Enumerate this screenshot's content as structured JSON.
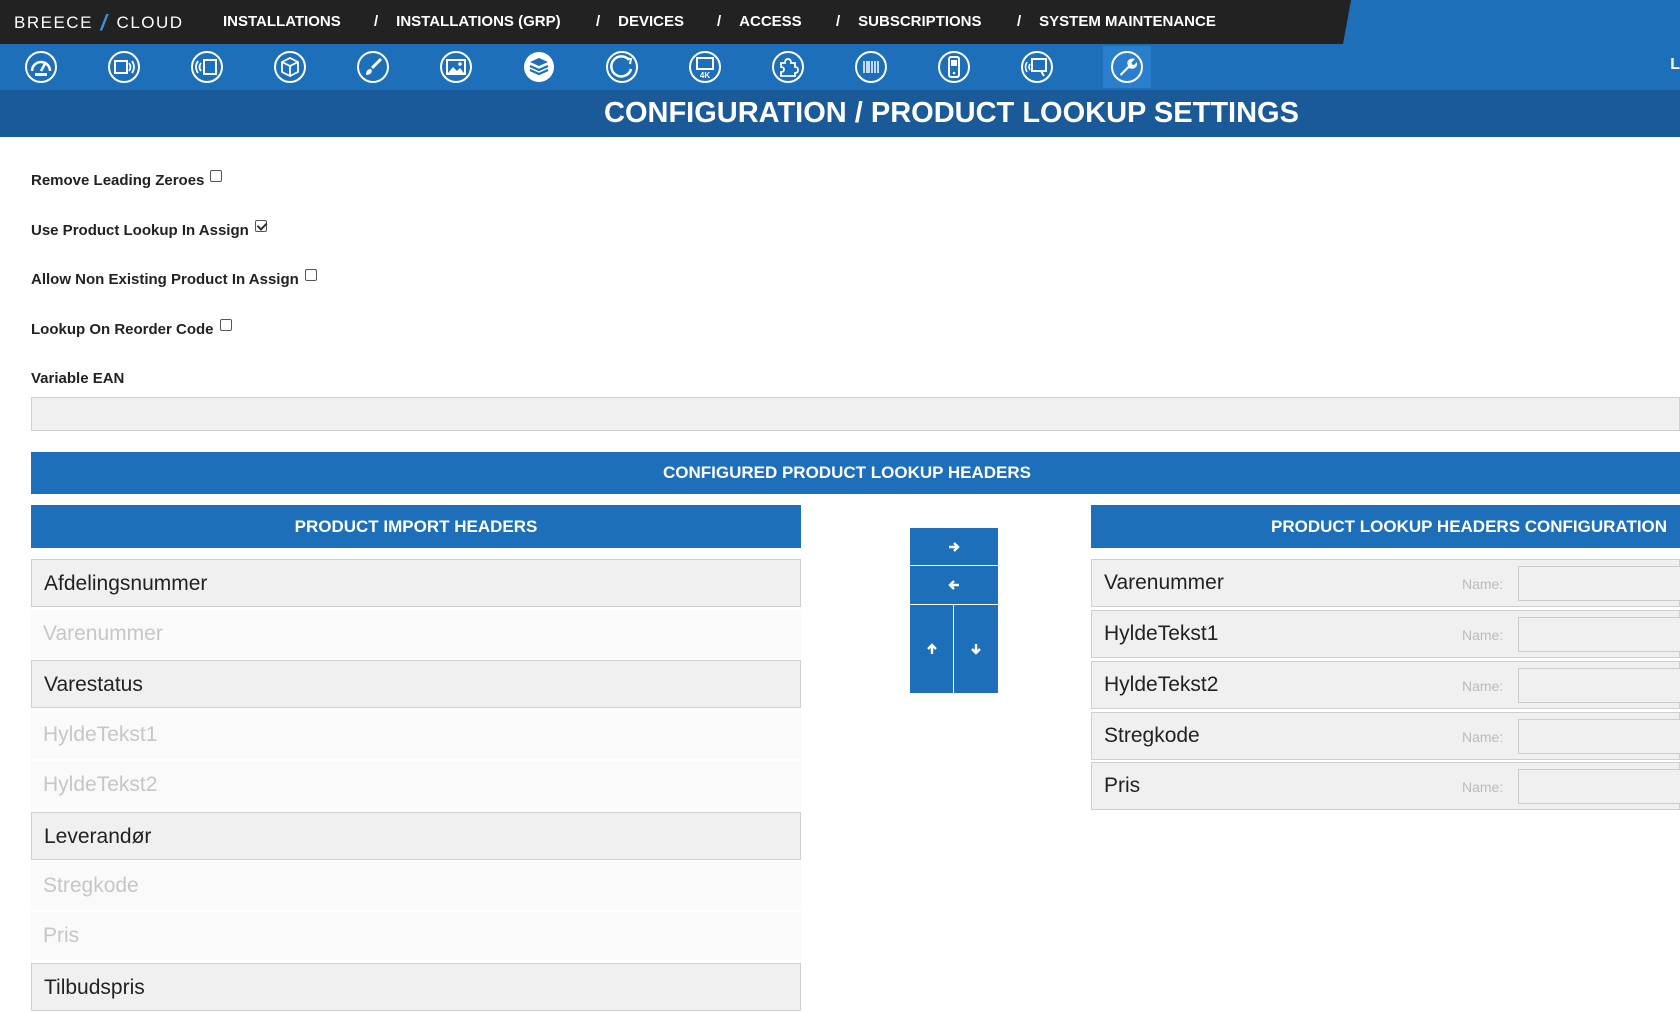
{
  "brand": {
    "left": "BREECE",
    "right": "CLOUD"
  },
  "topnav": [
    {
      "label": "INSTALLATIONS"
    },
    {
      "label": "INSTALLATIONS (GRP)"
    },
    {
      "label": "DEVICES"
    },
    {
      "label": "ACCESS"
    },
    {
      "label": "SUBSCRIPTIONS"
    },
    {
      "label": "SYSTEM MAINTENANCE"
    }
  ],
  "nav_separator": "/",
  "toolbar": {
    "icons": [
      "dashboard-icon",
      "sensor-icon",
      "wireless-tag-icon",
      "package-icon",
      "brush-icon",
      "gallery-icon",
      "layers-icon",
      "refresh-circle-icon",
      "monitor-4k-icon",
      "puzzle-icon",
      "barcode-scanner-icon",
      "handheld-device-icon",
      "signage-icon",
      "wrench-icon"
    ],
    "right_text": "L"
  },
  "page_title": "CONFIGURATION / PRODUCT LOOKUP SETTINGS",
  "options": [
    {
      "label": "Remove Leading Zeroes",
      "checked": false
    },
    {
      "label": "Use Product Lookup In Assign",
      "checked": true
    },
    {
      "label": "Allow Non Existing Product In Assign",
      "checked": false
    },
    {
      "label": "Lookup On Reorder Code",
      "checked": false
    }
  ],
  "variable_ean": {
    "label": "Variable EAN",
    "value": ""
  },
  "configured_header": "CONFIGURED PRODUCT LOOKUP HEADERS",
  "import_headers": {
    "title": "PRODUCT IMPORT HEADERS",
    "items": [
      {
        "label": "Afdelingsnummer",
        "enabled": true
      },
      {
        "label": "Varenummer",
        "enabled": false
      },
      {
        "label": "Varestatus",
        "enabled": true
      },
      {
        "label": "HyldeTekst1",
        "enabled": false
      },
      {
        "label": "HyldeTekst2",
        "enabled": false
      },
      {
        "label": "Leverandør",
        "enabled": true
      },
      {
        "label": "Stregkode",
        "enabled": false
      },
      {
        "label": "Pris",
        "enabled": false
      },
      {
        "label": "Tilbudspris",
        "enabled": true
      }
    ]
  },
  "lookup_config": {
    "title": "PRODUCT LOOKUP HEADERS CONFIGURATION",
    "name_label": "Name:",
    "items": [
      {
        "label": "Varenummer",
        "name_value": ""
      },
      {
        "label": "HyldeTekst1",
        "name_value": ""
      },
      {
        "label": "HyldeTekst2",
        "name_value": ""
      },
      {
        "label": "Stregkode",
        "name_value": ""
      },
      {
        "label": "Pris",
        "name_value": ""
      }
    ]
  },
  "colors": {
    "dark_bar": "#222222",
    "primary_blue": "#1c6fb8",
    "title_blue": "#1a5a98"
  }
}
